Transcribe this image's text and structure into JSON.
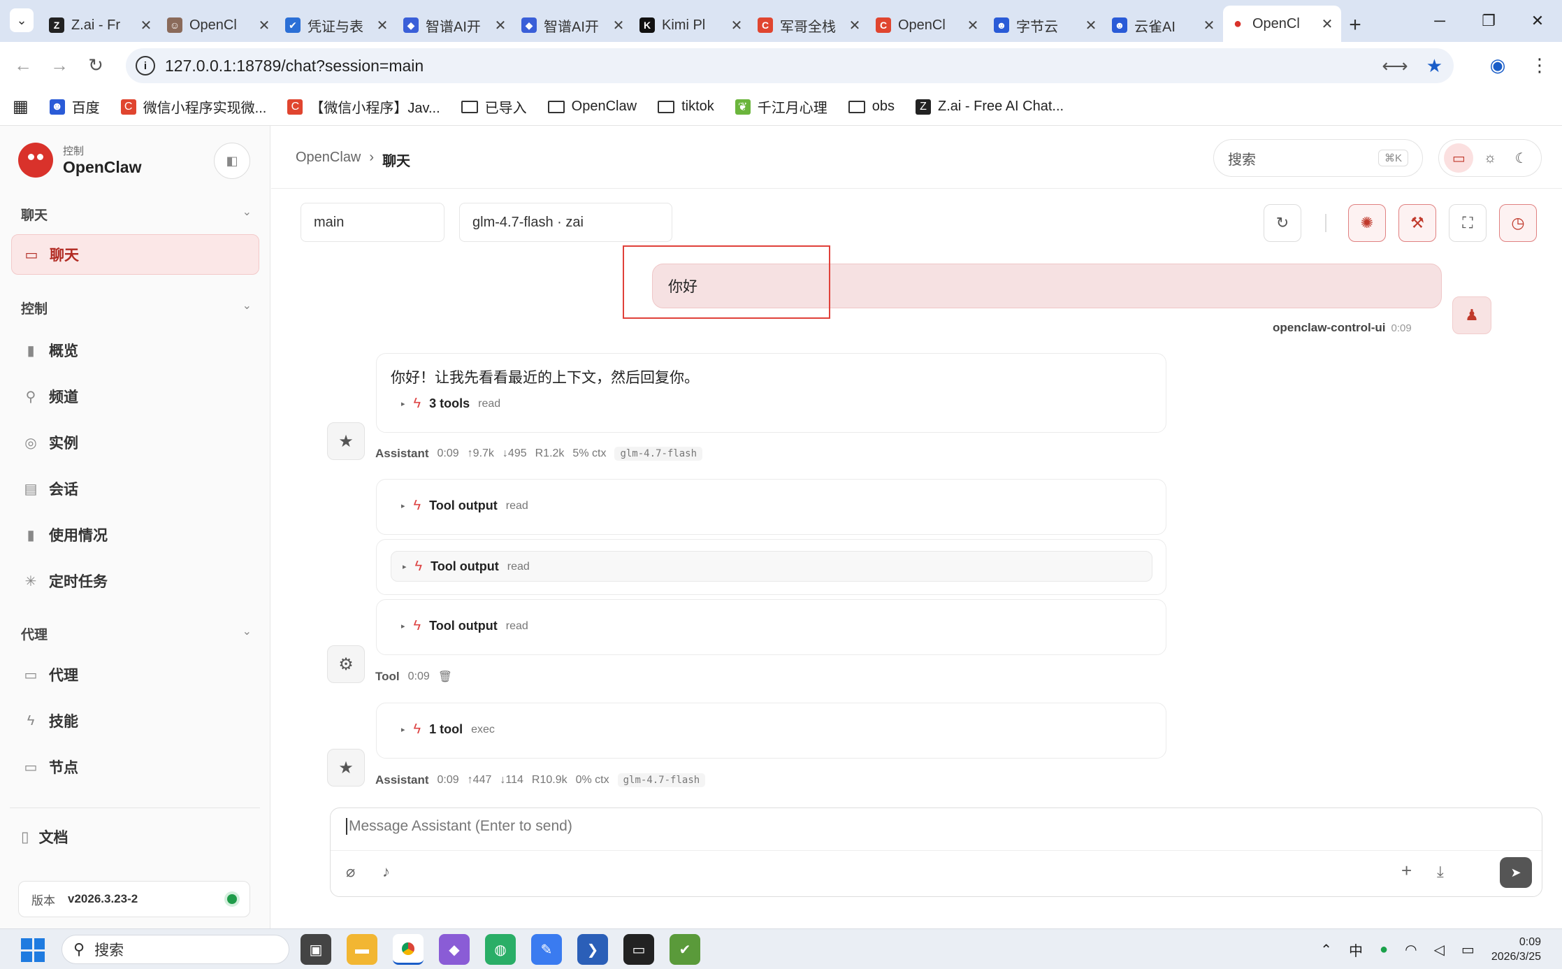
{
  "browser": {
    "tabs": [
      {
        "title": "Z.ai - Fr",
        "color": "#222222",
        "glyph": "Z"
      },
      {
        "title": "OpenCl",
        "color": "#8a6a5a",
        "glyph": "☺"
      },
      {
        "title": "凭证与表",
        "color": "#2b6fd6",
        "glyph": "✔"
      },
      {
        "title": "智谱AI开",
        "color": "#3a5fd8",
        "glyph": "◆"
      },
      {
        "title": "智谱AI开",
        "color": "#3a5fd8",
        "glyph": "◆"
      },
      {
        "title": "Kimi Pl",
        "color": "#111111",
        "glyph": "K"
      },
      {
        "title": "军哥全栈",
        "color": "#e0452f",
        "glyph": "C"
      },
      {
        "title": "OpenCl",
        "color": "#e0452f",
        "glyph": "C"
      },
      {
        "title": "字节云",
        "color": "#2a5bd7",
        "glyph": "☻"
      },
      {
        "title": "云雀AI",
        "color": "#2a5bd7",
        "glyph": "☻"
      },
      {
        "title": "OpenCl",
        "color": "#d9322b",
        "glyph": "●"
      }
    ],
    "url": "127.0.0.1:18789/chat?session=main",
    "bookmarks": [
      {
        "label": "百度",
        "kind": "icon",
        "color": "#2a5bd7",
        "glyph": "☻"
      },
      {
        "label": "微信小程序实现微...",
        "kind": "icon",
        "color": "#e0452f",
        "glyph": "C"
      },
      {
        "label": "【微信小程序】Jav...",
        "kind": "icon",
        "color": "#e0452f",
        "glyph": "C"
      },
      {
        "label": "已导入",
        "kind": "folder"
      },
      {
        "label": "OpenClaw",
        "kind": "folder"
      },
      {
        "label": "tiktok",
        "kind": "folder"
      },
      {
        "label": "千江月心理",
        "kind": "icon",
        "color": "#6bb53c",
        "glyph": "❦"
      },
      {
        "label": "obs",
        "kind": "folder"
      },
      {
        "label": "Z.ai - Free AI Chat...",
        "kind": "icon",
        "color": "#222222",
        "glyph": "Z"
      }
    ]
  },
  "sidebar": {
    "brand_sub": "控制",
    "brand_name": "OpenClaw",
    "sections": {
      "chat": "聊天",
      "control": "控制",
      "agent": "代理"
    },
    "items": {
      "chat": "聊天",
      "overview": "概览",
      "channels": "频道",
      "instances": "实例",
      "sessions": "会话",
      "usage": "使用情况",
      "cron": "定时任务",
      "agents": "代理",
      "skills": "技能",
      "nodes": "节点"
    },
    "docs": "文档",
    "version_label": "版本",
    "version_value": "v2026.3.23-2"
  },
  "header": {
    "crumb_root": "OpenClaw",
    "crumb_sep": "›",
    "crumb_current": "聊天",
    "search_placeholder": "搜索",
    "search_shortcut": "⌘K"
  },
  "chat": {
    "session": "main",
    "model": "glm-4.7-flash · zai",
    "user_message": "你好",
    "user_name": "openclaw-control-ui",
    "user_time": "0:09",
    "assistant_text": "你好！让我先看看最近的上下文，然后回复你。",
    "tools_summary_1": {
      "count": "3 tools",
      "kind": "read"
    },
    "meta_1": {
      "who": "Assistant",
      "time": "0:09",
      "up": "↑9.7k",
      "down": "↓495",
      "r": "R1.2k",
      "ctx": "5% ctx",
      "model": "glm-4.7-flash"
    },
    "tool_outputs": [
      {
        "label": "Tool output",
        "kind": "read"
      },
      {
        "label": "Tool output",
        "kind": "read"
      },
      {
        "label": "Tool output",
        "kind": "read"
      }
    ],
    "tool_meta": {
      "who": "Tool",
      "time": "0:09"
    },
    "tools_summary_2": {
      "count": "1 tool",
      "kind": "exec"
    },
    "meta_2": {
      "who": "Assistant",
      "time": "0:09",
      "up": "↑447",
      "down": "↓114",
      "r": "R10.9k",
      "ctx": "0% ctx",
      "model": "glm-4.7-flash"
    },
    "composer_placeholder": "Message Assistant (Enter to send)"
  },
  "taskbar": {
    "search": "搜索",
    "ime": "中",
    "time": "0:09",
    "date": "2026/3/25"
  },
  "colors": {
    "accent": "#c0392b",
    "active_bg": "#fbe7e7",
    "user_bubble": "#f6e1e2"
  }
}
